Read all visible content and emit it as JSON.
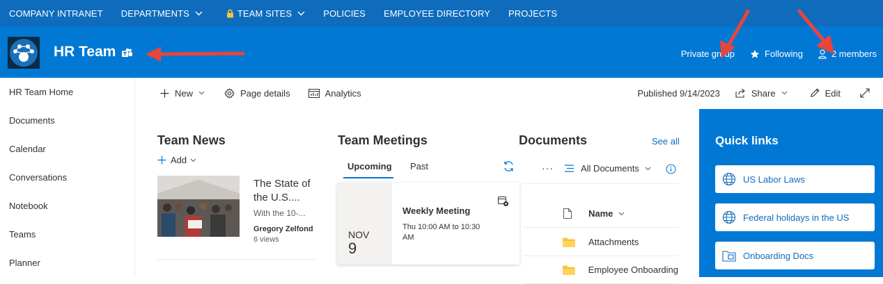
{
  "topnav": {
    "items": [
      {
        "label": "COMPANY INTRANET",
        "dropdown": false,
        "locked": false
      },
      {
        "label": "DEPARTMENTS",
        "dropdown": true,
        "locked": false
      },
      {
        "label": "TEAM SITES",
        "dropdown": true,
        "locked": true
      },
      {
        "label": "POLICIES",
        "dropdown": false,
        "locked": false
      },
      {
        "label": "EMPLOYEE DIRECTORY",
        "dropdown": false,
        "locked": false
      },
      {
        "label": "PROJECTS",
        "dropdown": false,
        "locked": false
      }
    ]
  },
  "header": {
    "site_title": "HR Team",
    "privacy": "Private group",
    "following": "Following",
    "members": "2 members",
    "logo_icon": "hr-team-logo",
    "teams_icon": "microsoft-teams-icon"
  },
  "sidebar": {
    "items": [
      {
        "label": "HR Team Home"
      },
      {
        "label": "Documents"
      },
      {
        "label": "Calendar"
      },
      {
        "label": "Conversations"
      },
      {
        "label": "Notebook"
      },
      {
        "label": "Teams"
      },
      {
        "label": "Planner"
      }
    ]
  },
  "commandbar": {
    "new_label": "New",
    "page_details_label": "Page details",
    "analytics_label": "Analytics",
    "published": "Published 9/14/2023",
    "share_label": "Share",
    "edit_label": "Edit"
  },
  "news": {
    "title": "Team News",
    "add_label": "Add",
    "article": {
      "title": "The State of the U.S....",
      "description": "With the 10-...",
      "author": "Gregory Zelfond",
      "views": "6 views"
    }
  },
  "meetings": {
    "title": "Team Meetings",
    "tabs": [
      "Upcoming",
      "Past"
    ],
    "event": {
      "month": "NOV",
      "day": "9",
      "title": "Weekly Meeting",
      "time": "Thu 10:00 AM to 10:30 AM"
    }
  },
  "documents": {
    "title": "Documents",
    "see_all": "See all",
    "view": "All Documents",
    "column_name": "Name",
    "rows": [
      {
        "name": "Attachments",
        "type": "folder"
      },
      {
        "name": "Employee Onboarding",
        "type": "folder"
      }
    ]
  },
  "quick_links": {
    "title": "Quick links",
    "items": [
      {
        "label": "US Labor Laws",
        "icon": "globe-icon"
      },
      {
        "label": "Federal holidays in the US",
        "icon": "globe-icon"
      },
      {
        "label": "Onboarding Docs",
        "icon": "folder-link-icon"
      }
    ]
  },
  "colors": {
    "topnav": "#0f6cbd",
    "header": "#0078d4",
    "accent": "#0078d4",
    "annotation_arrow": "#e8453c",
    "folder": "#f8c33b"
  }
}
